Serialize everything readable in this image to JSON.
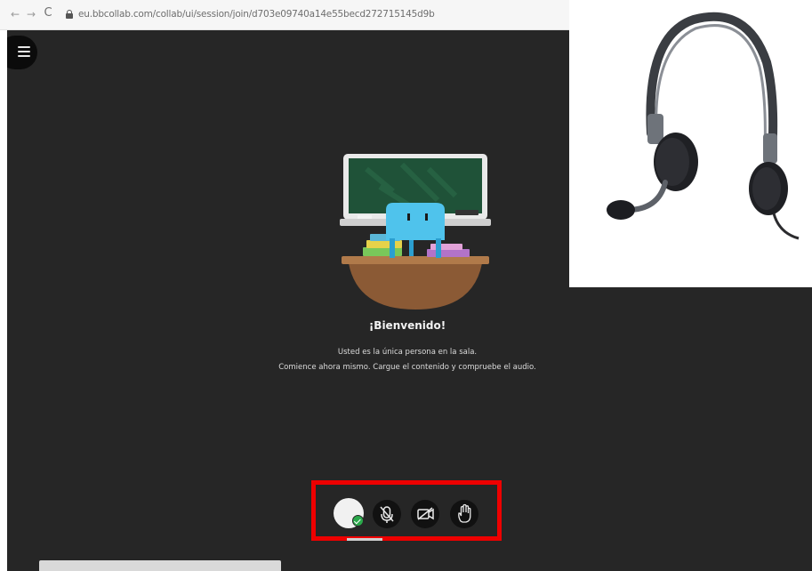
{
  "browser": {
    "url": "eu.bbcollab.com/collab/ui/session/join/d703e09740a14e55becd272715145d9b",
    "back_icon": "arrow-left-icon",
    "forward_icon": "arrow-right-icon",
    "reload_icon": "reload-icon",
    "glyphs": {
      "back": "←",
      "forward": "→",
      "reload": "C"
    }
  },
  "session": {
    "menu_icon": "hamburger-menu-icon",
    "welcome_title": "¡Bienvenido!",
    "welcome_line1": "Usted es la única persona en la sala.",
    "welcome_line2": "Comience ahora mismo. Cargue el contenido y compruebe el audio."
  },
  "controls": [
    {
      "name": "avatar",
      "icon": "user-avatar-icon",
      "status": "connected-check-icon"
    },
    {
      "name": "microphone",
      "icon": "microphone-off-icon"
    },
    {
      "name": "camera",
      "icon": "camera-off-icon"
    },
    {
      "name": "raise-hand",
      "icon": "hand-icon"
    }
  ],
  "colors": {
    "app_background": "#262626",
    "highlight_border": "#ee0000",
    "status_green": "#2aa84a"
  },
  "photo": {
    "subject": "headset-icon"
  }
}
